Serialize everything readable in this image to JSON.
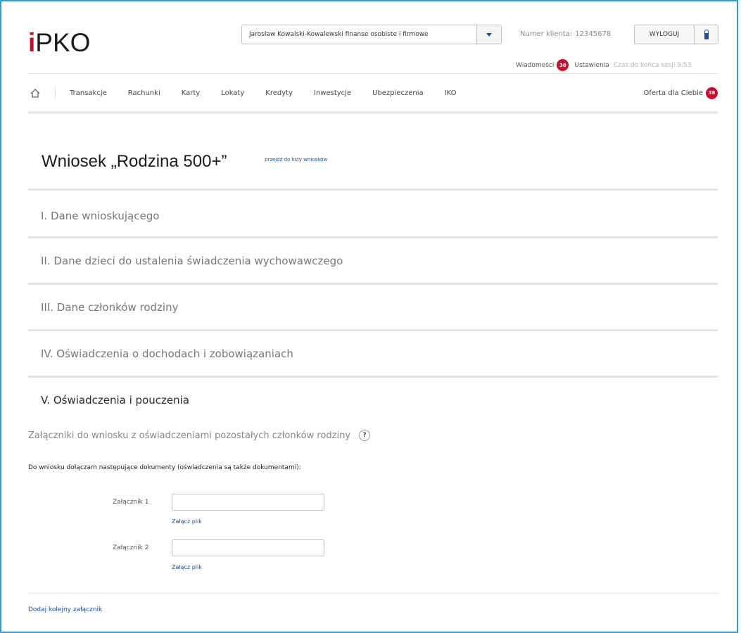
{
  "header": {
    "logo_i": "i",
    "logo_rest": "PKO",
    "account_selector": "Jarosław Kowalski-Kowalewski finanse osobiste i firmowe",
    "client_label": "Numer klienta:",
    "client_number": "12345678",
    "logout_label": "WYLOGUJ",
    "messages_label": "Wiadomości",
    "messages_count": "38",
    "settings_label": "Ustawienia",
    "session_text": "Czas do końca sesji 9:53"
  },
  "nav": {
    "items": [
      "Transakcje",
      "Rachunki",
      "Karty",
      "Lokaty",
      "Kredyty",
      "Inwestycje",
      "Ubezpieczenia",
      "IKO"
    ],
    "offer_label": "Oferta dla Ciebie",
    "offer_count": "38"
  },
  "page": {
    "title": "Wniosek „Rodzina 500+”",
    "title_link": "przejdź do listy wniosków"
  },
  "sections": [
    "I. Dane wnioskującego",
    "II. Dane dzieci do ustalenia świadczenia wychowawczego",
    "III. Dane członków rodziny",
    "IV. Oświadczenia o dochodach i zobowiązaniach",
    "V. Oświadczenia i pouczenia"
  ],
  "attachments": {
    "heading": "Załączniki do wniosku z oświadczeniami pozostałych członków rodziny",
    "help_glyph": "?",
    "intro": "Do wniosku dołączam następujące dokumenty (oświadczenia są także dokumentami):",
    "items": [
      {
        "label": "Załącznik 1",
        "value": "",
        "link": "Załącz plik"
      },
      {
        "label": "Załącznik 2",
        "value": "",
        "link": "Załącz plik"
      }
    ],
    "add_more": "Dodaj kolejny załącznik"
  },
  "colors": {
    "accent": "#1b4e9c",
    "brand_red": "#c8102e",
    "frame": "#2a9fd6"
  },
  "icons": {
    "home": "home-icon",
    "lock": "lock-icon",
    "dropdown": "chevron-down-icon",
    "help": "help-icon"
  }
}
